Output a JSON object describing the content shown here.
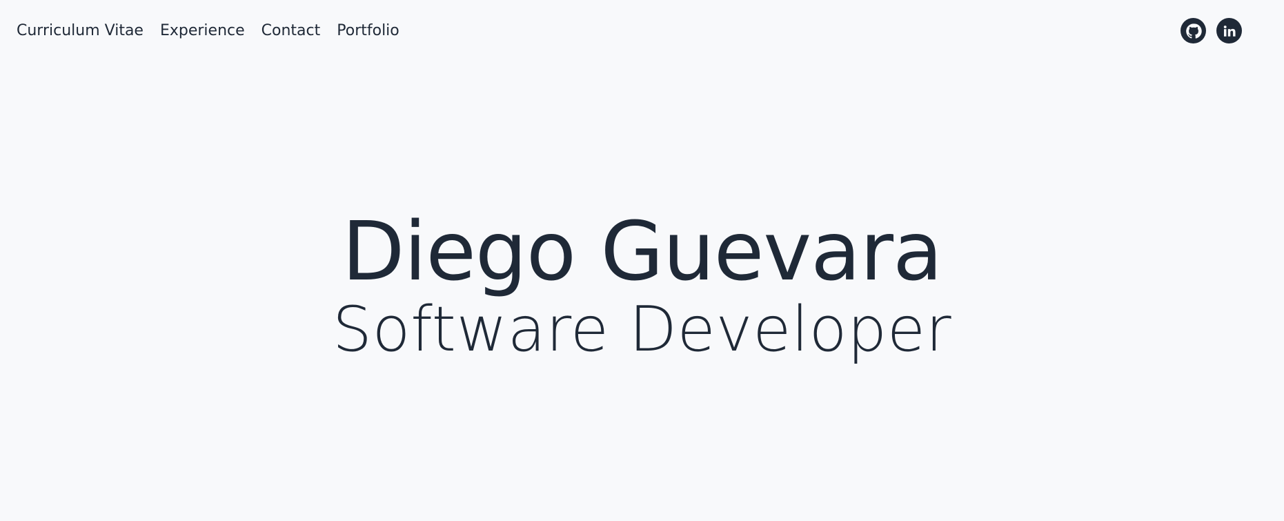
{
  "nav": {
    "links": [
      {
        "label": "Curriculum Vitae"
      },
      {
        "label": "Experience"
      },
      {
        "label": "Contact"
      },
      {
        "label": "Portfolio"
      }
    ],
    "social": [
      {
        "icon": "github-icon"
      },
      {
        "icon": "linkedin-icon"
      }
    ]
  },
  "hero": {
    "name": "Diego Guevara",
    "title": "Software Developer"
  },
  "colors": {
    "background": "#f8f9fb",
    "text": "#1f2937"
  }
}
